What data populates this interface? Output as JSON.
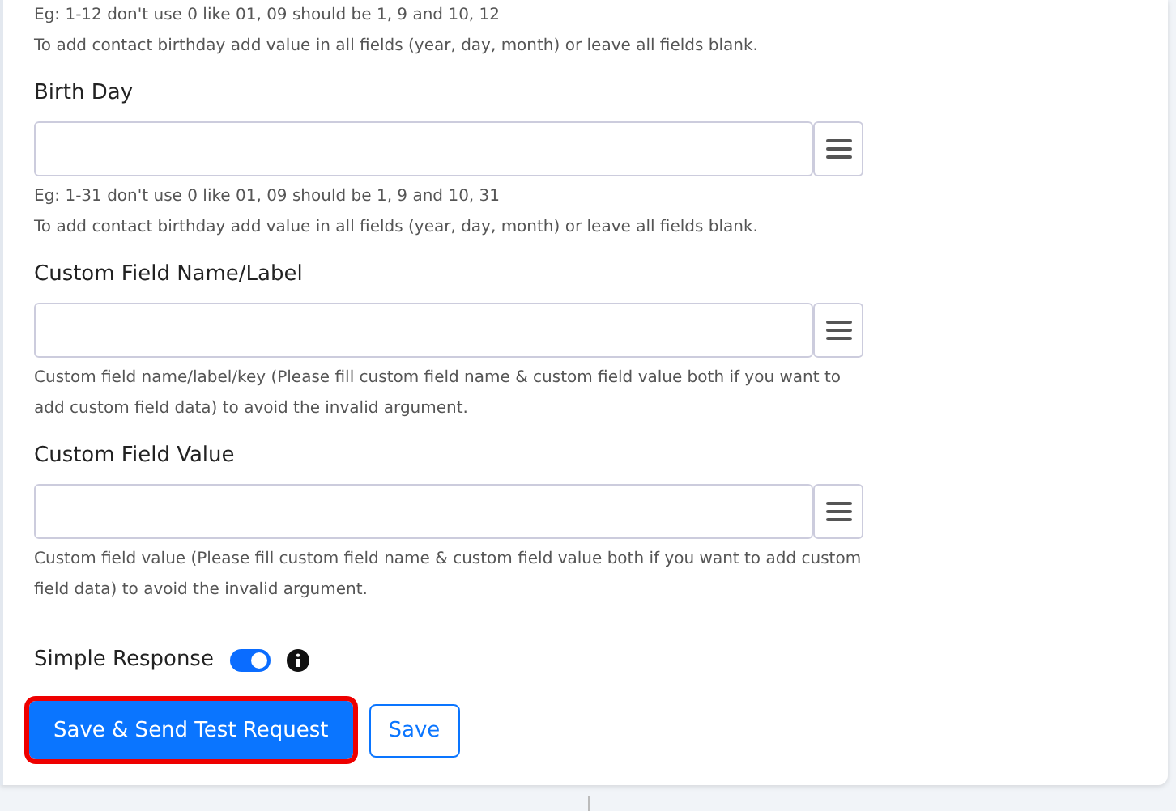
{
  "top_notes": [
    "Eg: 1-12 don't use 0 like 01, 09 should be 1, 9 and 10, 12",
    "To add contact birthday add value in all fields (year, day, month) or leave all fields blank."
  ],
  "fields": [
    {
      "label": "Birth Day",
      "notes": [
        "Eg: 1-31 don't use 0 like 01, 09 should be 1, 9 and 10, 31",
        "To add contact birthday add value in all fields (year, day, month) or leave all fields blank."
      ]
    },
    {
      "label": "Custom Field Name/Label",
      "notes": [
        "Custom field name/label/key (Please fill custom field name & custom field value both if you want to add custom field data) to avoid the invalid argument."
      ]
    },
    {
      "label": "Custom Field Value",
      "notes": [
        "Custom field value (Please fill custom field name & custom field value both if you want to add custom field data) to avoid the invalid argument."
      ]
    }
  ],
  "simple_response": {
    "label": "Simple Response",
    "on": true
  },
  "buttons": [
    {
      "label": "Save & Send Test Request",
      "kind": "primary",
      "highlighted": true
    },
    {
      "label": "Save",
      "kind": "outline",
      "highlighted": false
    }
  ]
}
